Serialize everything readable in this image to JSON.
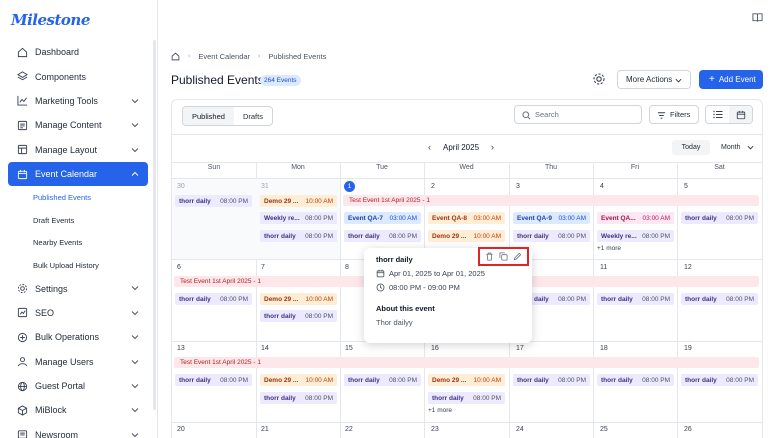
{
  "brand": {
    "logo": "Milestone",
    "accent": "#2563eb"
  },
  "sidebar": {
    "items": [
      {
        "label": "Dashboard",
        "icon": "home-icon"
      },
      {
        "label": "Components",
        "icon": "layers-icon"
      },
      {
        "label": "Marketing Tools",
        "icon": "chart-icon"
      },
      {
        "label": "Manage Content",
        "icon": "content-icon"
      },
      {
        "label": "Manage Layout",
        "icon": "layout-icon"
      },
      {
        "label": "Event Calendar",
        "icon": "calendar-icon",
        "active": true
      },
      {
        "label": "Settings",
        "icon": "gear-icon"
      },
      {
        "label": "SEO",
        "icon": "seo-icon"
      },
      {
        "label": "Bulk Operations",
        "icon": "bulk-icon"
      },
      {
        "label": "Manage Users",
        "icon": "users-icon"
      },
      {
        "label": "Guest Portal",
        "icon": "globe-icon"
      },
      {
        "label": "MiBlock",
        "icon": "cube-icon"
      },
      {
        "label": "Newsroom",
        "icon": "news-icon"
      }
    ],
    "subitems": [
      {
        "label": "Published Events",
        "active": true
      },
      {
        "label": "Draft Events"
      },
      {
        "label": "Nearby Events"
      },
      {
        "label": "Bulk Upload History"
      }
    ]
  },
  "breadcrumb": {
    "items": [
      "Event Calendar",
      "Published Events"
    ]
  },
  "header": {
    "title": "Published Events",
    "count_badge": "264 Events",
    "more_actions": "More Actions",
    "add_event": "Add Event"
  },
  "toolbar": {
    "tabs": [
      "Published",
      "Drafts"
    ],
    "search_placeholder": "Search",
    "filters": "Filters"
  },
  "calendar": {
    "month_label": "April 2025",
    "today": "Today",
    "view": "Month",
    "weekdays": [
      "Sun",
      "Mon",
      "Tue",
      "Wed",
      "Thu",
      "Fri",
      "Sat"
    ],
    "week1": [
      "30",
      "31",
      "1",
      "2",
      "3",
      "4",
      "5"
    ],
    "week2": [
      "6",
      "7",
      "8",
      "9",
      "10",
      "11",
      "12"
    ],
    "week3": [
      "13",
      "14",
      "15",
      "16",
      "17",
      "18",
      "19"
    ],
    "week4": [
      "20",
      "21",
      "22",
      "23",
      "24",
      "25",
      "26"
    ],
    "span_w1": "Test Event 1st April 2025 - 1",
    "span_w2": "Test Event 1st April 2025 - 1",
    "span_w3": "Test Event 1st April 2025 - 1",
    "events": {
      "thorr": {
        "title": "thorr daily",
        "time": "08:00 PM"
      },
      "demo": {
        "title": "Demo 29 ...",
        "time": "10:00 AM"
      },
      "weekly1": {
        "title": "Weekly re...",
        "time": "08:00 PM"
      },
      "weekly2": {
        "title": "Weekly re...",
        "time": "08:00 PM"
      },
      "qa7": {
        "title": "Event QA-7",
        "time": "03:00 AM"
      },
      "qa8": {
        "title": "Event QA-8",
        "time": "03:00 AM"
      },
      "qa9": {
        "title": "Event QA-9",
        "time": "03:00 AM"
      },
      "qa_fri": {
        "title": "Event QA...",
        "time": "03:00 AM"
      }
    },
    "more_w1": "+1 more",
    "more_w3": "+1 more"
  },
  "popover": {
    "title": "thorr daily",
    "date_range": "Apr 01, 2025 to Apr 01, 2025",
    "time_range": "08:00 PM - 09:00 PM",
    "about_heading": "About this event",
    "description": "Thor dailyy"
  }
}
